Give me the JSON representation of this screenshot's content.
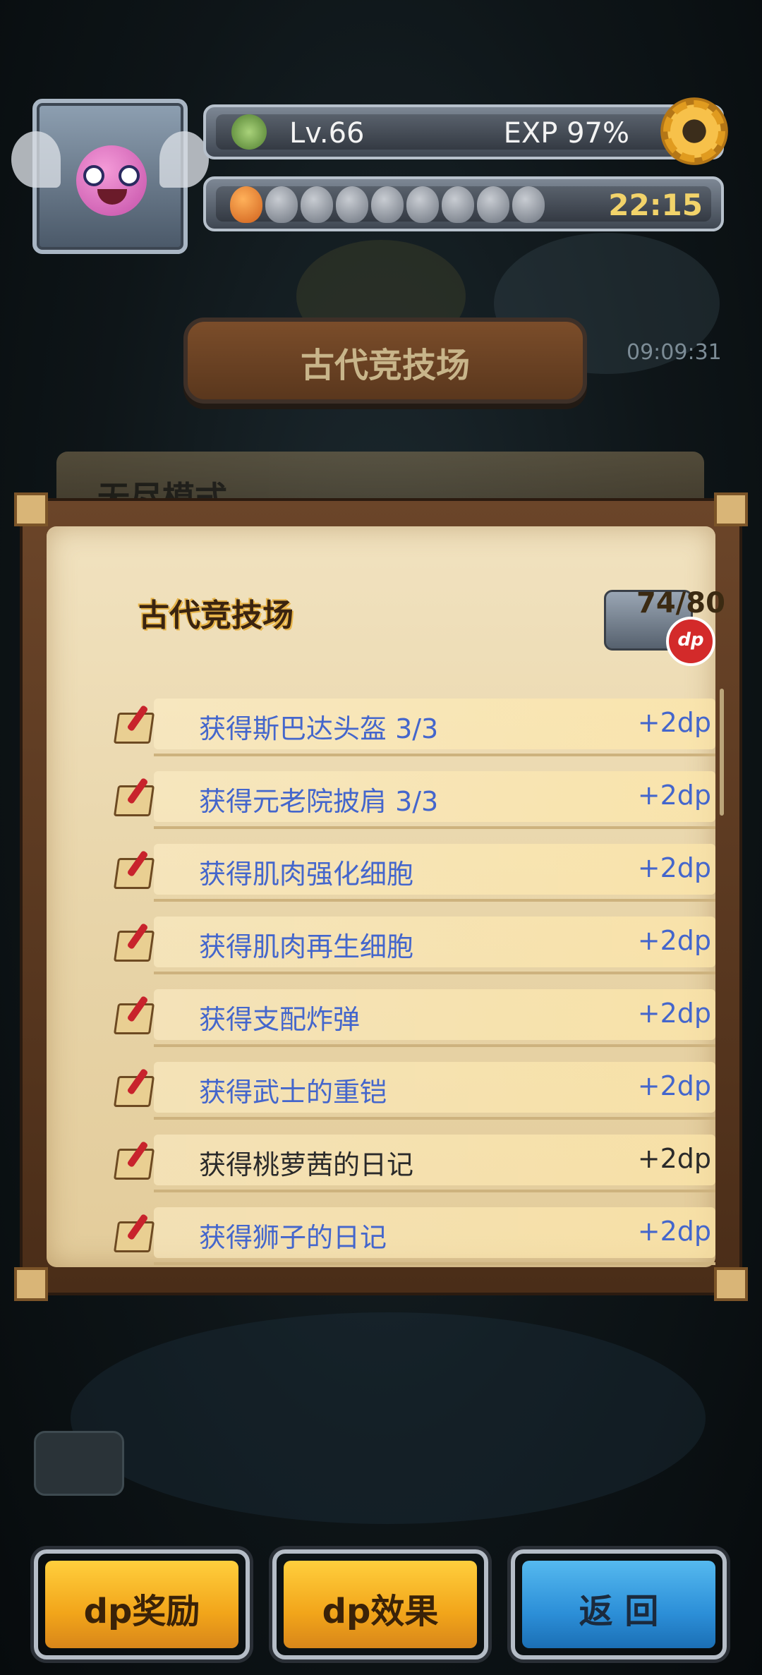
{
  "hud": {
    "level": "Lv.66",
    "exp": "EXP 97%",
    "timer": "22:15",
    "seed_count": 9
  },
  "background": {
    "title": "古代竞技场",
    "timer": "09:09:31",
    "card_title": "无尽模式"
  },
  "panel": {
    "title": "古代竞技场",
    "progress": "74/80",
    "badge": "dp",
    "items": [
      {
        "name": "获得斯巴达头盔 3/3",
        "points": "+2dp",
        "done": false
      },
      {
        "name": "获得元老院披肩 3/3",
        "points": "+2dp",
        "done": false
      },
      {
        "name": "获得肌肉强化细胞",
        "points": "+2dp",
        "done": false
      },
      {
        "name": "获得肌肉再生细胞",
        "points": "+2dp",
        "done": false
      },
      {
        "name": "获得支配炸弹",
        "points": "+2dp",
        "done": false
      },
      {
        "name": "获得武士的重铠",
        "points": "+2dp",
        "done": false
      },
      {
        "name": "获得桃萝茜的日记",
        "points": "+2dp",
        "done": true
      },
      {
        "name": "获得狮子的日记",
        "points": "+2dp",
        "done": false
      }
    ]
  },
  "buttons": {
    "reward": "dp奖励",
    "effect": "dp效果",
    "back": "返 回"
  }
}
